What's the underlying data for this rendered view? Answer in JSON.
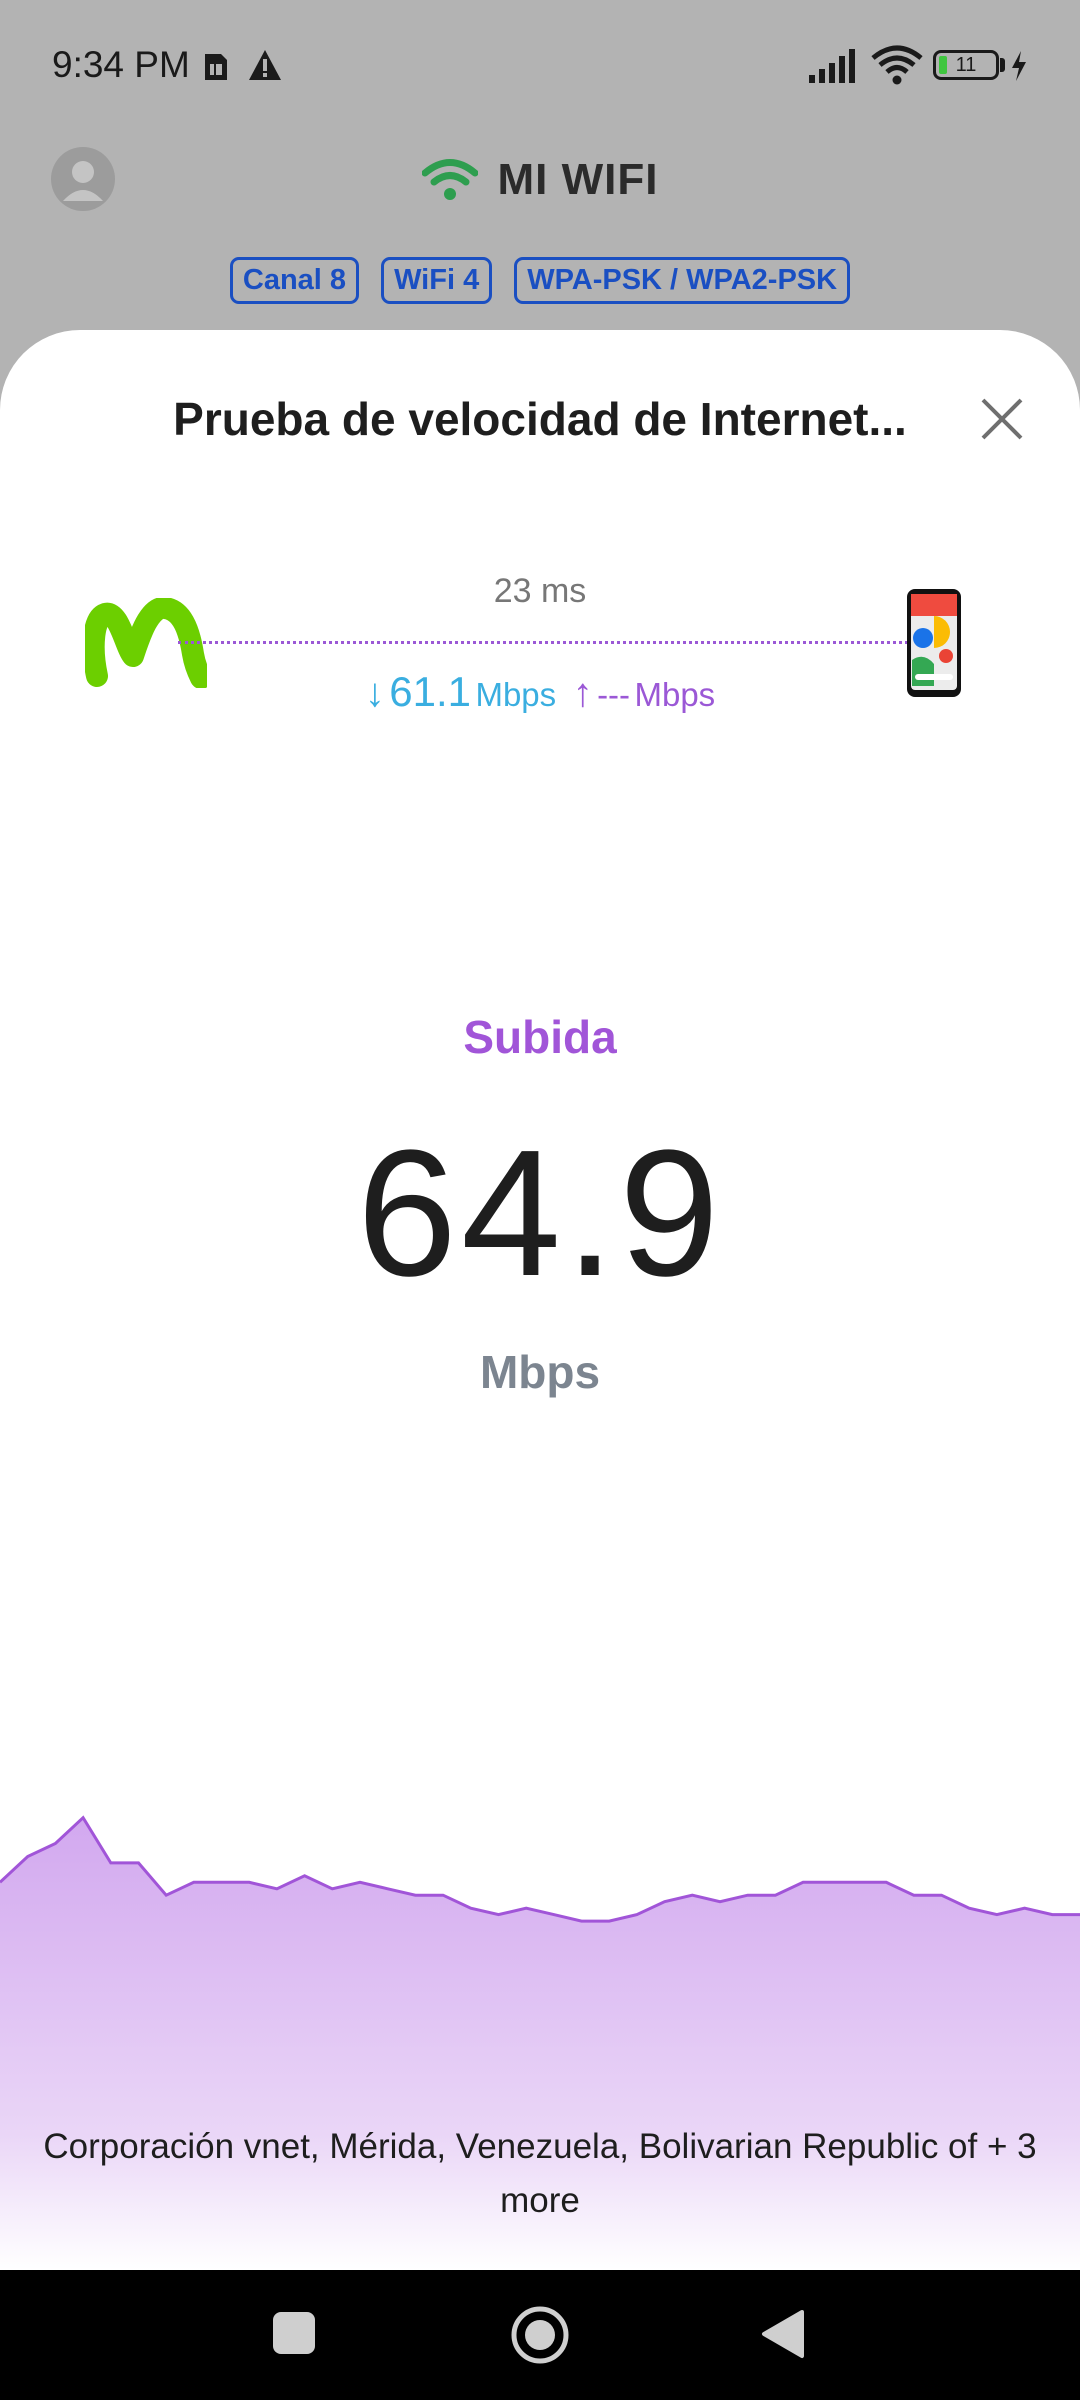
{
  "status": {
    "time": "9:34 PM",
    "battery_level": "11"
  },
  "header": {
    "title": "MI WIFI",
    "tags": [
      "Canal 8",
      "WiFi 4",
      "WPA-PSK / WPA2-PSK"
    ]
  },
  "sheet": {
    "title": "Prueba de velocidad de Internet...",
    "ping": "23 ms",
    "download_arrow": "↓",
    "download_value": "61.1",
    "download_unit": "Mbps",
    "upload_arrow": "↑",
    "upload_value": "---",
    "upload_unit": "Mbps",
    "phase": "Subida",
    "speed_value": "64.9",
    "speed_unit": "Mbps",
    "server": "Corporación vnet, Mérida, Venezuela, Bolivarian Republic of + 3 more"
  },
  "colors": {
    "accent": "#a155d8",
    "download": "#3aaee0",
    "tag": "#1a4fc2",
    "wifi": "#2e9e4f",
    "isp": "#6ccf00"
  },
  "chart_data": {
    "type": "area",
    "series": [
      {
        "values": [
          60,
          64,
          66,
          70,
          63,
          63,
          58,
          60,
          60,
          60,
          59,
          61,
          59,
          60,
          59,
          58,
          58,
          56,
          55,
          56,
          55,
          54,
          54,
          55,
          57,
          58,
          57,
          58,
          58,
          60,
          60,
          60,
          60,
          58,
          58,
          56,
          55,
          56,
          55,
          55
        ]
      }
    ],
    "ylim": [
      0,
      130
    ]
  }
}
